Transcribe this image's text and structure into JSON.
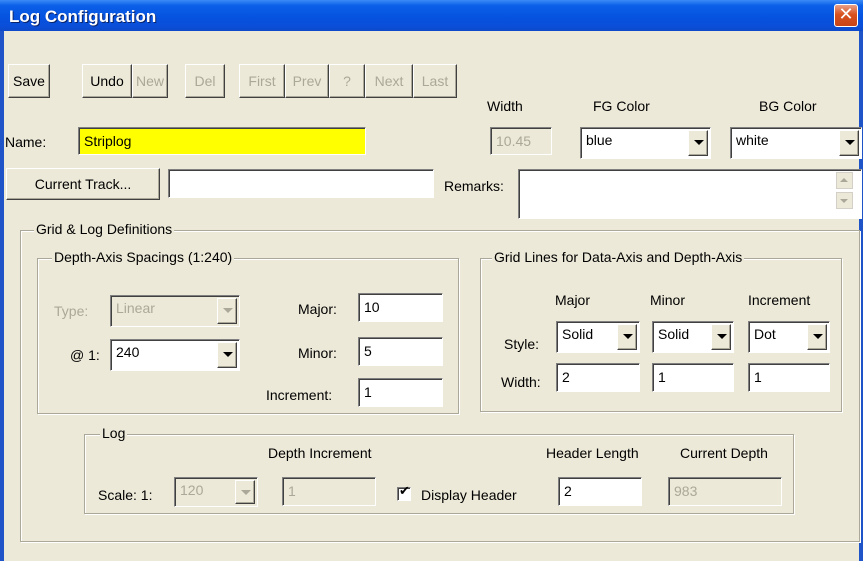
{
  "window": {
    "title": "Log Configuration",
    "close_glyph": "✕"
  },
  "toolbar": {
    "save": "Save",
    "undo": "Undo",
    "new": "New",
    "del": "Del",
    "first": "First",
    "prev": "Prev",
    "help": "?",
    "next": "Next",
    "last": "Last"
  },
  "header_labels": {
    "width": "Width",
    "fg_color": "FG Color",
    "bg_color": "BG Color"
  },
  "name": {
    "label": "Name:",
    "value": "Striplog"
  },
  "width_value": "10.45",
  "fg_color_value": "blue",
  "bg_color_value": "white",
  "current_track": {
    "button": "Current Track...",
    "value": ""
  },
  "remarks": {
    "label": "Remarks:",
    "value": ""
  },
  "grid_log": {
    "legend": "Grid & Log Definitions",
    "depth_axis": {
      "legend": "Depth-Axis Spacings (1:240)",
      "type_label": "Type:",
      "type_value": "Linear",
      "at1_label": "@ 1:",
      "at1_value": "240",
      "major_label": "Major:",
      "major_value": "10",
      "minor_label": "Minor:",
      "minor_value": "5",
      "increment_label": "Increment:",
      "increment_value": "1"
    },
    "grid_lines": {
      "legend": "Grid Lines for Data-Axis and Depth-Axis",
      "col_major": "Major",
      "col_minor": "Minor",
      "col_increment": "Increment",
      "style_label": "Style:",
      "width_label": "Width:",
      "style_major": "Solid",
      "style_minor": "Solid",
      "style_increment": "Dot",
      "width_major": "2",
      "width_minor": "1",
      "width_increment": "1"
    },
    "log": {
      "legend": "Log",
      "scale_label": "Scale: 1:",
      "scale_value": "120",
      "depth_increment_label": "Depth Increment",
      "depth_increment_value": "1",
      "display_header_label": "Display Header",
      "display_header_checked": true,
      "header_length_label": "Header Length",
      "header_length_value": "2",
      "current_depth_label": "Current Depth",
      "current_depth_value": "983"
    }
  }
}
